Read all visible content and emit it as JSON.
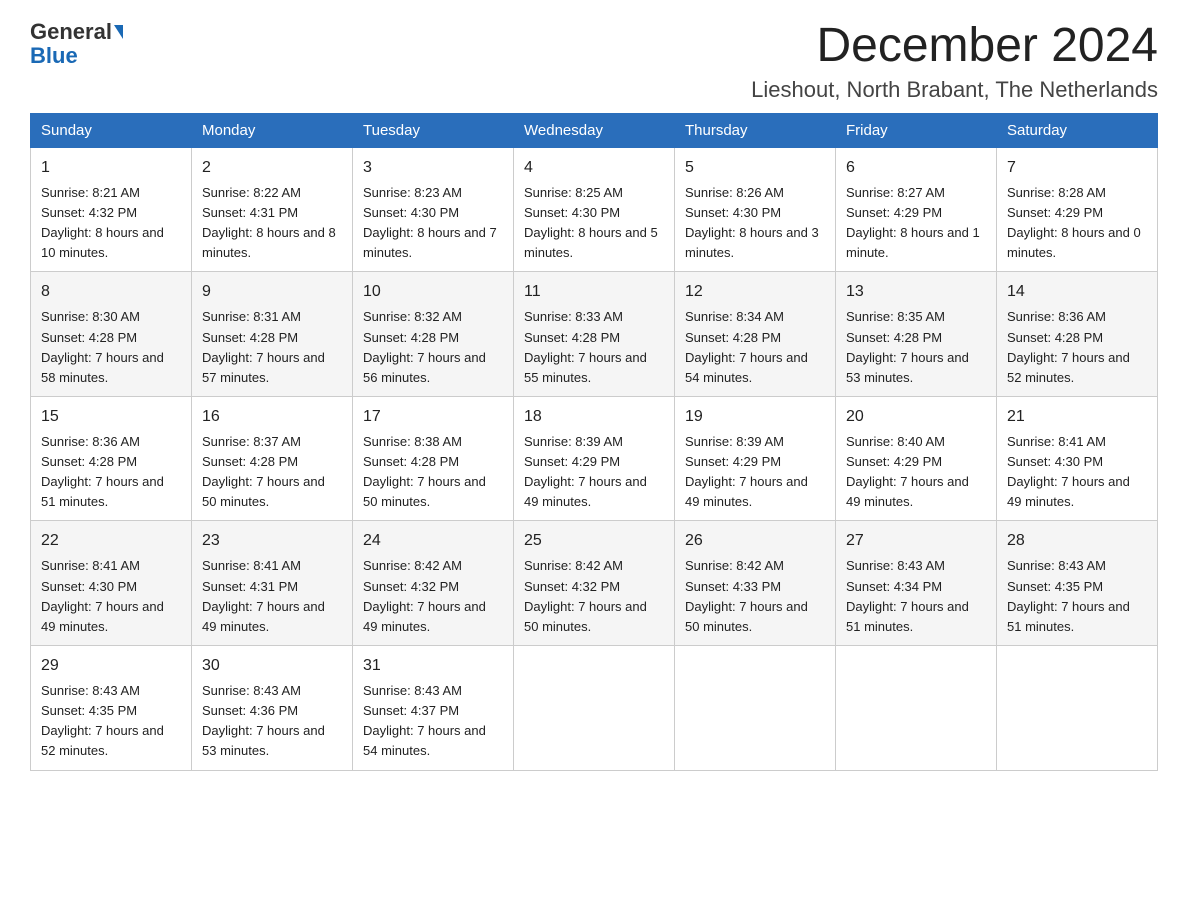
{
  "header": {
    "logo_general": "General",
    "logo_blue": "Blue",
    "month_title": "December 2024",
    "location": "Lieshout, North Brabant, The Netherlands"
  },
  "weekdays": [
    "Sunday",
    "Monday",
    "Tuesday",
    "Wednesday",
    "Thursday",
    "Friday",
    "Saturday"
  ],
  "weeks": [
    [
      {
        "day": "1",
        "sunrise": "8:21 AM",
        "sunset": "4:32 PM",
        "daylight": "8 hours and 10 minutes."
      },
      {
        "day": "2",
        "sunrise": "8:22 AM",
        "sunset": "4:31 PM",
        "daylight": "8 hours and 8 minutes."
      },
      {
        "day": "3",
        "sunrise": "8:23 AM",
        "sunset": "4:30 PM",
        "daylight": "8 hours and 7 minutes."
      },
      {
        "day": "4",
        "sunrise": "8:25 AM",
        "sunset": "4:30 PM",
        "daylight": "8 hours and 5 minutes."
      },
      {
        "day": "5",
        "sunrise": "8:26 AM",
        "sunset": "4:30 PM",
        "daylight": "8 hours and 3 minutes."
      },
      {
        "day": "6",
        "sunrise": "8:27 AM",
        "sunset": "4:29 PM",
        "daylight": "8 hours and 1 minute."
      },
      {
        "day": "7",
        "sunrise": "8:28 AM",
        "sunset": "4:29 PM",
        "daylight": "8 hours and 0 minutes."
      }
    ],
    [
      {
        "day": "8",
        "sunrise": "8:30 AM",
        "sunset": "4:28 PM",
        "daylight": "7 hours and 58 minutes."
      },
      {
        "day": "9",
        "sunrise": "8:31 AM",
        "sunset": "4:28 PM",
        "daylight": "7 hours and 57 minutes."
      },
      {
        "day": "10",
        "sunrise": "8:32 AM",
        "sunset": "4:28 PM",
        "daylight": "7 hours and 56 minutes."
      },
      {
        "day": "11",
        "sunrise": "8:33 AM",
        "sunset": "4:28 PM",
        "daylight": "7 hours and 55 minutes."
      },
      {
        "day": "12",
        "sunrise": "8:34 AM",
        "sunset": "4:28 PM",
        "daylight": "7 hours and 54 minutes."
      },
      {
        "day": "13",
        "sunrise": "8:35 AM",
        "sunset": "4:28 PM",
        "daylight": "7 hours and 53 minutes."
      },
      {
        "day": "14",
        "sunrise": "8:36 AM",
        "sunset": "4:28 PM",
        "daylight": "7 hours and 52 minutes."
      }
    ],
    [
      {
        "day": "15",
        "sunrise": "8:36 AM",
        "sunset": "4:28 PM",
        "daylight": "7 hours and 51 minutes."
      },
      {
        "day": "16",
        "sunrise": "8:37 AM",
        "sunset": "4:28 PM",
        "daylight": "7 hours and 50 minutes."
      },
      {
        "day": "17",
        "sunrise": "8:38 AM",
        "sunset": "4:28 PM",
        "daylight": "7 hours and 50 minutes."
      },
      {
        "day": "18",
        "sunrise": "8:39 AM",
        "sunset": "4:29 PM",
        "daylight": "7 hours and 49 minutes."
      },
      {
        "day": "19",
        "sunrise": "8:39 AM",
        "sunset": "4:29 PM",
        "daylight": "7 hours and 49 minutes."
      },
      {
        "day": "20",
        "sunrise": "8:40 AM",
        "sunset": "4:29 PM",
        "daylight": "7 hours and 49 minutes."
      },
      {
        "day": "21",
        "sunrise": "8:41 AM",
        "sunset": "4:30 PM",
        "daylight": "7 hours and 49 minutes."
      }
    ],
    [
      {
        "day": "22",
        "sunrise": "8:41 AM",
        "sunset": "4:30 PM",
        "daylight": "7 hours and 49 minutes."
      },
      {
        "day": "23",
        "sunrise": "8:41 AM",
        "sunset": "4:31 PM",
        "daylight": "7 hours and 49 minutes."
      },
      {
        "day": "24",
        "sunrise": "8:42 AM",
        "sunset": "4:32 PM",
        "daylight": "7 hours and 49 minutes."
      },
      {
        "day": "25",
        "sunrise": "8:42 AM",
        "sunset": "4:32 PM",
        "daylight": "7 hours and 50 minutes."
      },
      {
        "day": "26",
        "sunrise": "8:42 AM",
        "sunset": "4:33 PM",
        "daylight": "7 hours and 50 minutes."
      },
      {
        "day": "27",
        "sunrise": "8:43 AM",
        "sunset": "4:34 PM",
        "daylight": "7 hours and 51 minutes."
      },
      {
        "day": "28",
        "sunrise": "8:43 AM",
        "sunset": "4:35 PM",
        "daylight": "7 hours and 51 minutes."
      }
    ],
    [
      {
        "day": "29",
        "sunrise": "8:43 AM",
        "sunset": "4:35 PM",
        "daylight": "7 hours and 52 minutes."
      },
      {
        "day": "30",
        "sunrise": "8:43 AM",
        "sunset": "4:36 PM",
        "daylight": "7 hours and 53 minutes."
      },
      {
        "day": "31",
        "sunrise": "8:43 AM",
        "sunset": "4:37 PM",
        "daylight": "7 hours and 54 minutes."
      },
      null,
      null,
      null,
      null
    ]
  ]
}
